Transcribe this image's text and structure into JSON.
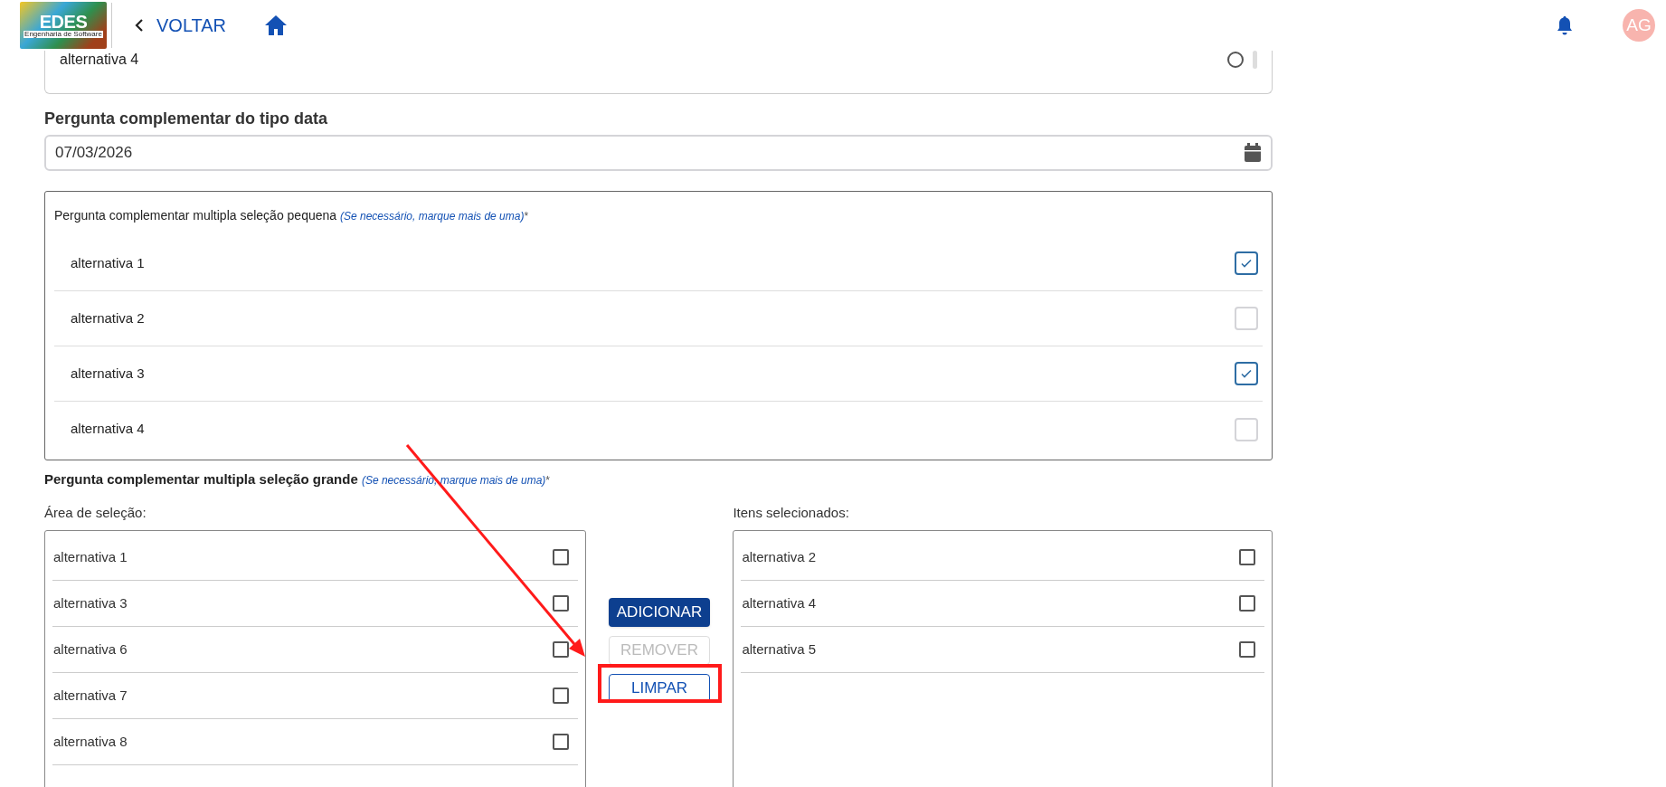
{
  "header": {
    "logo": {
      "title": "EDES",
      "subtitle": "Engenharia de Software"
    },
    "back_label": "VOLTAR",
    "avatar": "AG"
  },
  "previous_question": {
    "options": [
      {
        "label": "alternativa 4",
        "selected": false
      }
    ]
  },
  "date_question": {
    "label": "Pergunta complementar do tipo data",
    "value": "07/03/2026"
  },
  "small_multi": {
    "label": "Pergunta complementar multipla seleção pequena",
    "hint": "(Se necessário, marque mais de uma)",
    "required": "*",
    "options": [
      {
        "label": "alternativa 1",
        "checked": true
      },
      {
        "label": "alternativa 2",
        "checked": false
      },
      {
        "label": "alternativa 3",
        "checked": true
      },
      {
        "label": "alternativa 4",
        "checked": false
      }
    ]
  },
  "large_multi": {
    "label": "Pergunta complementar multipla seleção grande",
    "hint": "(Se necessário, marque mais de uma)",
    "required": "*",
    "available": {
      "title": "Área de seleção:",
      "items": [
        {
          "label": "alternativa 1",
          "checked": false
        },
        {
          "label": "alternativa 3",
          "checked": false
        },
        {
          "label": "alternativa 6",
          "checked": false
        },
        {
          "label": "alternativa 7",
          "checked": false
        },
        {
          "label": "alternativa 8",
          "checked": false
        }
      ]
    },
    "buttons": [
      {
        "label": "ADICIONAR",
        "kind": "primary",
        "disabled": false
      },
      {
        "label": "REMOVER",
        "kind": "outline",
        "disabled": true
      },
      {
        "label": "LIMPAR",
        "kind": "outline",
        "disabled": false
      }
    ],
    "selected": {
      "title": "Itens selecionados:",
      "items": [
        {
          "label": "alternativa 2",
          "checked": false
        },
        {
          "label": "alternativa 4",
          "checked": false
        },
        {
          "label": "alternativa 5",
          "checked": false
        }
      ]
    }
  }
}
